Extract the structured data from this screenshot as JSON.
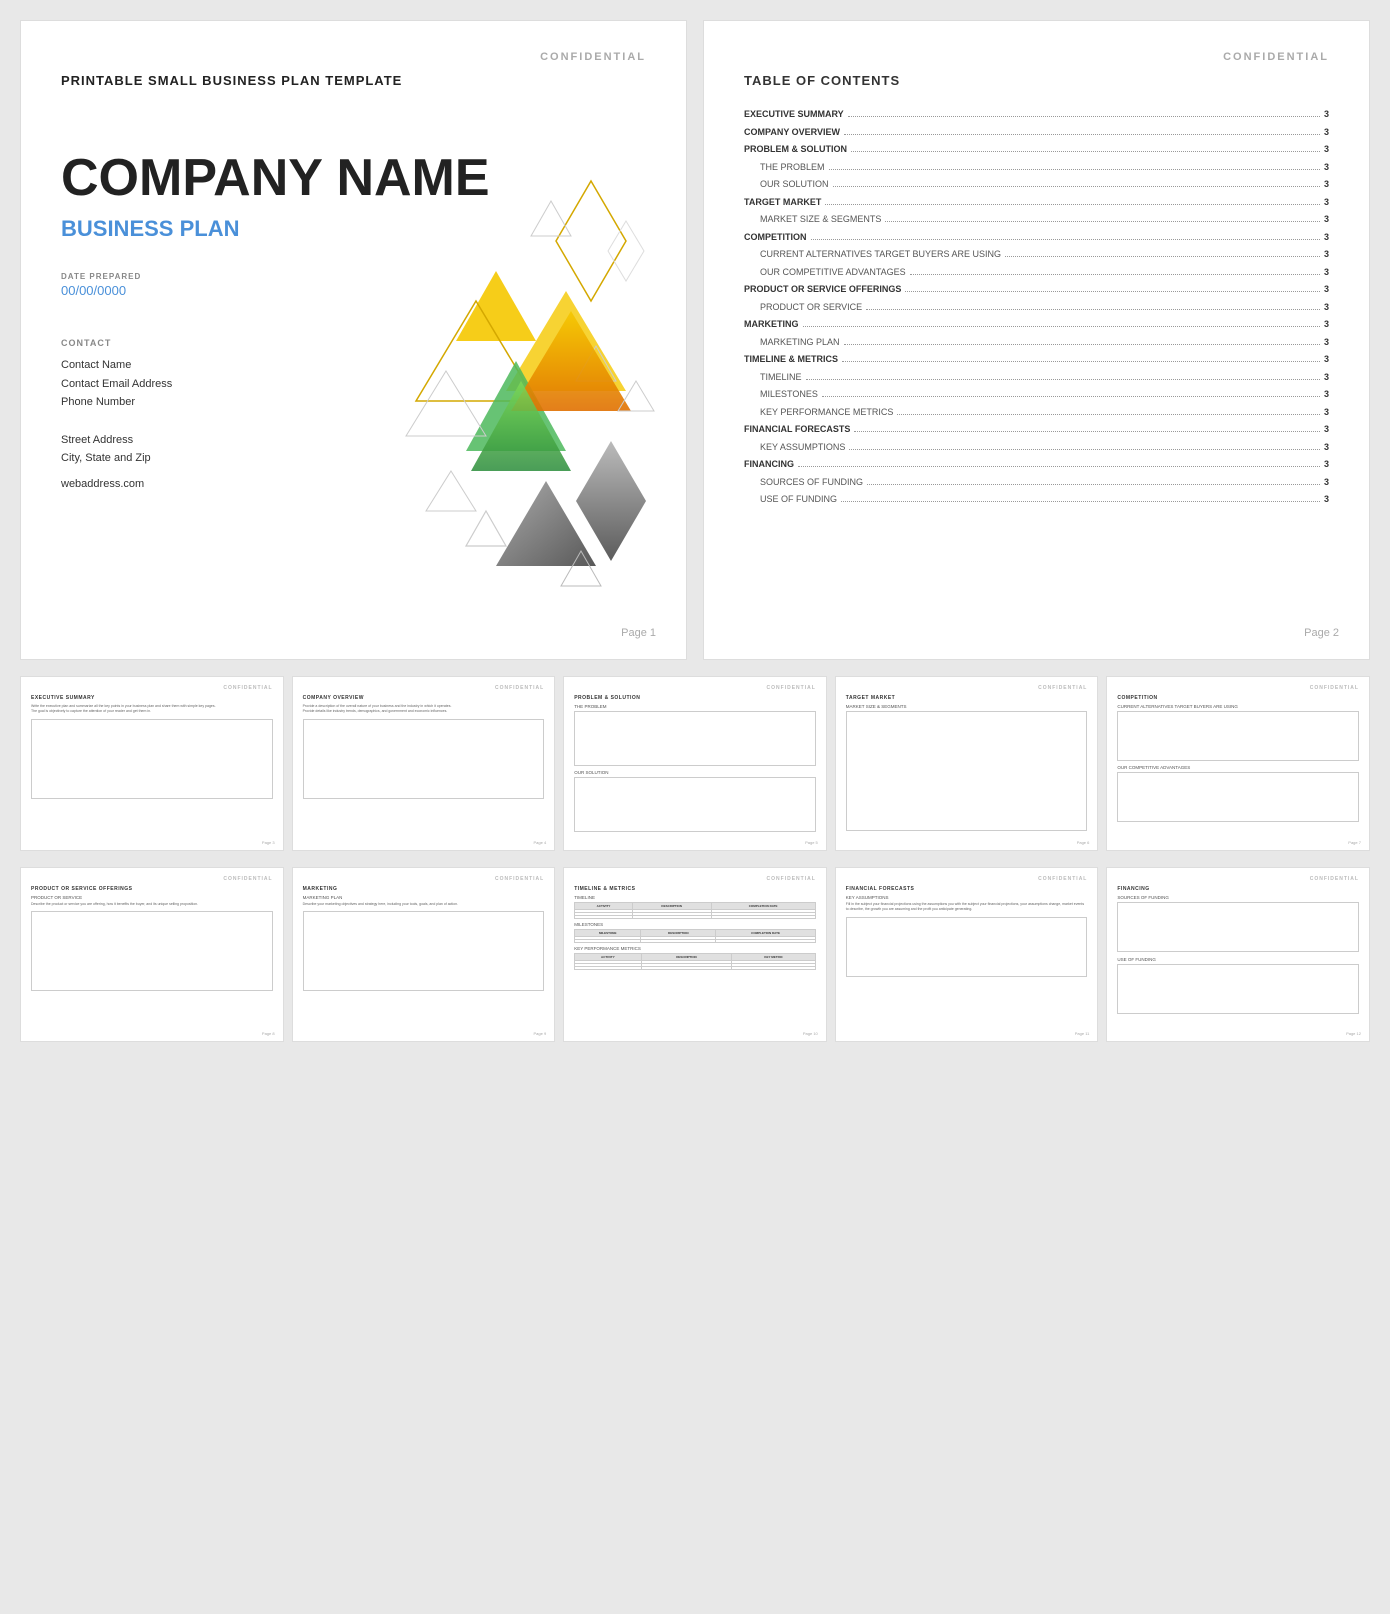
{
  "page_background": "#e8e8e8",
  "confidential_text": "CONFIDENTIAL",
  "page1": {
    "template_title": "PRINTABLE SMALL BUSINESS PLAN TEMPLATE",
    "company_name": "COMPANY NAME",
    "business_plan_label": "BUSINESS PLAN",
    "date_label": "DATE PREPARED",
    "date_value": "00/00/0000",
    "contact_label": "CONTACT",
    "contact_lines": [
      "Contact Name",
      "Contact Email Address",
      "Phone Number",
      "",
      "Street Address",
      "City, State and Zip"
    ],
    "web_address": "webaddress.com",
    "page_number": "Page 1"
  },
  "page2": {
    "toc_title": "TABLE OF CONTENTS",
    "toc_items": [
      {
        "label": "EXECUTIVE SUMMARY",
        "page": "3",
        "bold": true,
        "indent": false
      },
      {
        "label": "COMPANY OVERVIEW",
        "page": "3",
        "bold": true,
        "indent": false
      },
      {
        "label": "PROBLEM & SOLUTION",
        "page": "3",
        "bold": true,
        "indent": false
      },
      {
        "label": "THE PROBLEM",
        "page": "3",
        "bold": false,
        "indent": true
      },
      {
        "label": "OUR SOLUTION",
        "page": "3",
        "bold": false,
        "indent": true
      },
      {
        "label": "TARGET MARKET",
        "page": "3",
        "bold": true,
        "indent": false
      },
      {
        "label": "MARKET SIZE & SEGMENTS",
        "page": "3",
        "bold": false,
        "indent": true
      },
      {
        "label": "COMPETITION",
        "page": "3",
        "bold": true,
        "indent": false
      },
      {
        "label": "CURRENT ALTERNATIVES TARGET BUYERS ARE USING",
        "page": "3",
        "bold": false,
        "indent": true
      },
      {
        "label": "OUR COMPETITIVE ADVANTAGES",
        "page": "3",
        "bold": false,
        "indent": true
      },
      {
        "label": "PRODUCT OR SERVICE OFFERINGS",
        "page": "3",
        "bold": true,
        "indent": false
      },
      {
        "label": "PRODUCT OR SERVICE",
        "page": "3",
        "bold": false,
        "indent": true
      },
      {
        "label": "MARKETING",
        "page": "3",
        "bold": true,
        "indent": false
      },
      {
        "label": "MARKETING PLAN",
        "page": "3",
        "bold": false,
        "indent": true
      },
      {
        "label": "TIMELINE & METRICS",
        "page": "3",
        "bold": true,
        "indent": false
      },
      {
        "label": "TIMELINE",
        "page": "3",
        "bold": false,
        "indent": true
      },
      {
        "label": "MILESTONES",
        "page": "3",
        "bold": false,
        "indent": true
      },
      {
        "label": "KEY PERFORMANCE METRICS",
        "page": "3",
        "bold": false,
        "indent": true
      },
      {
        "label": "FINANCIAL FORECASTS",
        "page": "3",
        "bold": true,
        "indent": false
      },
      {
        "label": "KEY ASSUMPTIONS",
        "page": "3",
        "bold": false,
        "indent": true
      },
      {
        "label": "FINANCING",
        "page": "3",
        "bold": true,
        "indent": false
      },
      {
        "label": "SOURCES OF FUNDING",
        "page": "3",
        "bold": false,
        "indent": true
      },
      {
        "label": "USE OF FUNDING",
        "page": "3",
        "bold": false,
        "indent": true
      }
    ],
    "page_number": "Page 2"
  },
  "thumbnails_row1": [
    {
      "title": "EXECUTIVE SUMMARY",
      "sub": "",
      "page": "Page 3",
      "type": "text"
    },
    {
      "title": "COMPANY OVERVIEW",
      "sub": "",
      "page": "Page 4",
      "type": "text"
    },
    {
      "title": "PROBLEM & SOLUTION",
      "sub": "THE PROBLEM",
      "page": "Page 5",
      "type": "boxes"
    },
    {
      "title": "TARGET MARKET",
      "sub": "MARKET SIZE & SEGMENTS",
      "page": "Page 6",
      "type": "box"
    },
    {
      "title": "COMPETITION",
      "sub": "CURRENT ALTERNATIVES TARGET BUYERS ARE USING",
      "page": "Page 7",
      "type": "two_boxes"
    }
  ],
  "thumbnails_row2": [
    {
      "title": "PRODUCT OR SERVICE OFFERINGS",
      "sub": "PRODUCT OR SERVICE",
      "page": "Page 8",
      "type": "text"
    },
    {
      "title": "MARKETING",
      "sub": "MARKETING PLAN",
      "page": "Page 9",
      "type": "text"
    },
    {
      "title": "TIMELINE & METRICS",
      "sub": "TIMELINE",
      "page": "Page 10",
      "type": "tables"
    },
    {
      "title": "FINANCIAL FORECASTS",
      "sub": "KEY ASSUMPTIONS",
      "page": "Page 11",
      "type": "text"
    },
    {
      "title": "FINANCING",
      "sub": "SOURCES OF FUNDING",
      "page": "Page 12",
      "type": "boxes"
    }
  ]
}
